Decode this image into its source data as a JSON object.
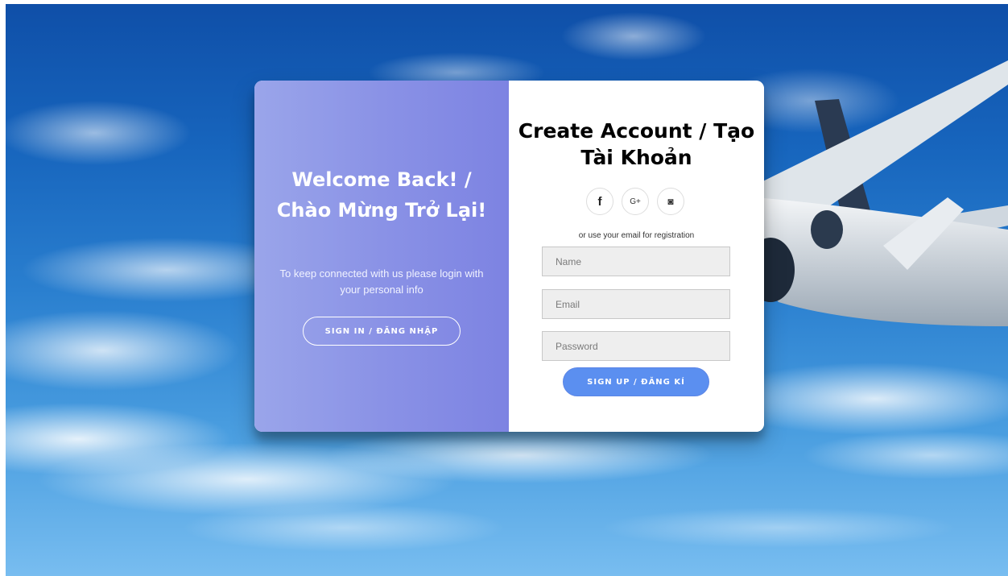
{
  "overlay": {
    "title": "Welcome Back! / Chào Mừng Trở Lại!",
    "text": "To keep connected with us please login with your personal info",
    "signin_label": "SIGN IN / ĐĂNG NHẬP"
  },
  "form": {
    "title": "Create Account / Tạo Tài Khoản",
    "social": [
      {
        "icon": "facebook-icon",
        "glyph": "f"
      },
      {
        "icon": "google-plus-icon",
        "glyph": "G+"
      },
      {
        "icon": "whatsapp-icon",
        "glyph": "◙"
      }
    ],
    "hint": "or use your email for registration",
    "name_placeholder": "Name",
    "email_placeholder": "Email",
    "password_placeholder": "Password",
    "signup_label": "SIGN UP / ĐĂNG KÍ"
  },
  "colors": {
    "overlay_gradient_start": "#9aa5ea",
    "overlay_gradient_end": "#7d83e2",
    "primary_button": "#5b8ff0",
    "sky": "#1765bd"
  }
}
